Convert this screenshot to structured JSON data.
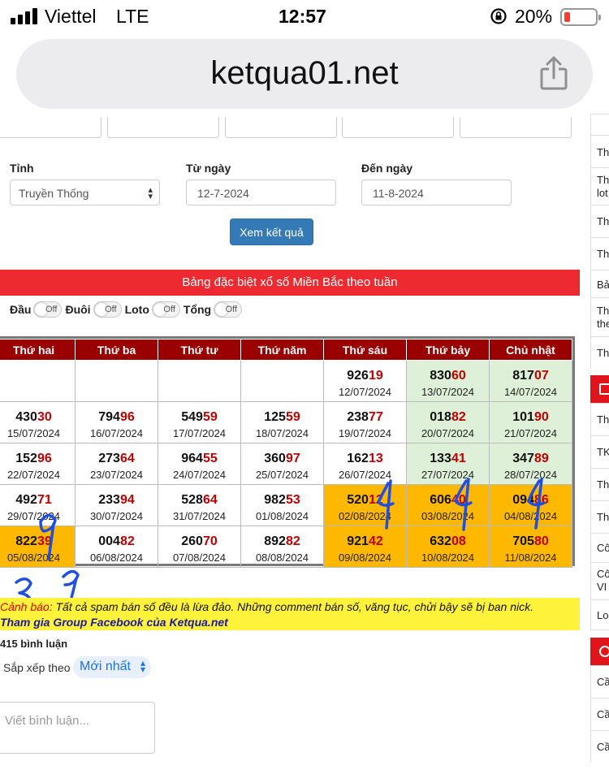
{
  "status": {
    "carrier": "Viettel",
    "network": "LTE",
    "time": "12:57",
    "battery": "20%"
  },
  "browser": {
    "url": "ketqua01.net"
  },
  "form": {
    "province_label": "Tỉnh",
    "province_value": "Truyền Thống",
    "from_label": "Từ ngày",
    "from_value": "12-7-2024",
    "to_label": "Đến ngày",
    "to_value": "11-8-2024",
    "submit": "Xem kết quả"
  },
  "banner": "Bảng đặc biệt xổ số Miền Bắc theo tuần",
  "toggles": [
    {
      "label": "Đầu",
      "state": "Off"
    },
    {
      "label": "Đuôi",
      "state": "Off"
    },
    {
      "label": "Loto",
      "state": "Off"
    },
    {
      "label": "Tổng",
      "state": "Off"
    }
  ],
  "table": {
    "headers": [
      "Thứ hai",
      "Thứ ba",
      "Thứ tư",
      "Thứ năm",
      "Thứ sáu",
      "Thứ bảy",
      "Chủ nhật"
    ],
    "rows": [
      [
        null,
        null,
        null,
        null,
        {
          "head": "926",
          "tail": "19",
          "date": "12/07/2024"
        },
        {
          "head": "830",
          "tail": "60",
          "date": "13/07/2024",
          "bg": "green"
        },
        {
          "head": "817",
          "tail": "07",
          "date": "14/07/2024",
          "bg": "green"
        }
      ],
      [
        {
          "head": "430",
          "tail": "30",
          "date": "15/07/2024"
        },
        {
          "head": "794",
          "tail": "96",
          "date": "16/07/2024"
        },
        {
          "head": "549",
          "tail": "59",
          "date": "17/07/2024"
        },
        {
          "head": "125",
          "tail": "59",
          "date": "18/07/2024"
        },
        {
          "head": "238",
          "tail": "77",
          "date": "19/07/2024"
        },
        {
          "head": "018",
          "tail": "82",
          "date": "20/07/2024",
          "bg": "green"
        },
        {
          "head": "101",
          "tail": "90",
          "date": "21/07/2024",
          "bg": "green"
        }
      ],
      [
        {
          "head": "152",
          "tail": "96",
          "date": "22/07/2024"
        },
        {
          "head": "273",
          "tail": "64",
          "date": "23/07/2024"
        },
        {
          "head": "964",
          "tail": "55",
          "date": "24/07/2024"
        },
        {
          "head": "360",
          "tail": "97",
          "date": "25/07/2024"
        },
        {
          "head": "162",
          "tail": "13",
          "date": "26/07/2024"
        },
        {
          "head": "133",
          "tail": "41",
          "date": "27/07/2024",
          "bg": "green"
        },
        {
          "head": "347",
          "tail": "89",
          "date": "28/07/2024",
          "bg": "green"
        }
      ],
      [
        {
          "head": "492",
          "tail": "71",
          "date": "29/07/2024"
        },
        {
          "head": "233",
          "tail": "94",
          "date": "30/07/2024"
        },
        {
          "head": "528",
          "tail": "64",
          "date": "31/07/2024"
        },
        {
          "head": "982",
          "tail": "53",
          "date": "01/08/2024"
        },
        {
          "head": "520",
          "tail": "12",
          "date": "02/08/2024",
          "bg": "orange"
        },
        {
          "head": "606",
          "tail": "40",
          "date": "03/08/2024",
          "bg": "orange"
        },
        {
          "head": "094",
          "tail": "86",
          "date": "04/08/2024",
          "bg": "orange"
        }
      ],
      [
        {
          "head": "822",
          "tail": "39",
          "date": "05/08/2024",
          "bg": "orange"
        },
        {
          "head": "004",
          "tail": "82",
          "date": "06/08/2024"
        },
        {
          "head": "260",
          "tail": "70",
          "date": "07/08/2024"
        },
        {
          "head": "892",
          "tail": "82",
          "date": "08/08/2024"
        },
        {
          "head": "921",
          "tail": "42",
          "date": "09/08/2024",
          "bg": "orange"
        },
        {
          "head": "632",
          "tail": "08",
          "date": "10/08/2024",
          "bg": "orange"
        },
        {
          "head": "705",
          "tail": "80",
          "date": "11/08/2024",
          "bg": "orange"
        }
      ]
    ]
  },
  "warning": {
    "head": "Cảnh báo:",
    "text": " Tất cả spam bán số đều là lừa đảo. Những comment bán số, văng tục, chửi bậy sẽ bị ban nick.",
    "link": "Tham gia Group Facebook của Ketqua.net"
  },
  "comments": {
    "count": "415 bình luận",
    "sort_label": "Sắp xếp theo",
    "sort_value": "Mới nhất",
    "placeholder": "Viết bình luận..."
  },
  "sidebar": {
    "items": [
      "Th",
      "Th",
      "lot",
      "Th",
      "Th",
      "Bả",
      "Th",
      "the",
      "Th",
      "Th",
      "TK",
      "Th",
      "Th",
      "Cô",
      "Cô",
      "VI",
      "Lo",
      "Cầ",
      "Cầ",
      "Cầ"
    ]
  },
  "colors": {
    "header_red": "#9b0000",
    "banner_red": "#ec2a2f",
    "green_cell": "#dff0d8",
    "orange_cell": "#ffb800",
    "button_blue": "#337ab7",
    "warning_yellow": "#fff23a"
  }
}
